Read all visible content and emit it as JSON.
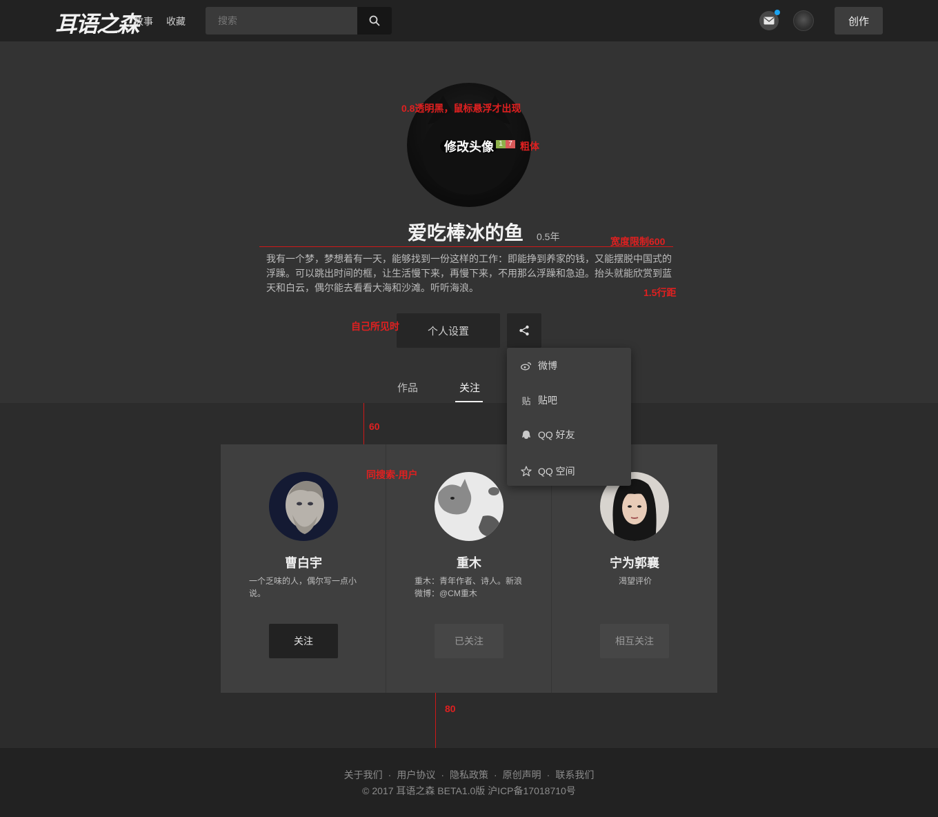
{
  "header": {
    "logo_text": "耳语之森",
    "nav": [
      "故事",
      "收藏"
    ],
    "search_placeholder": "搜索",
    "create_label": "创作"
  },
  "profile": {
    "edit_avatar_label": "修改头像",
    "edit_badge": [
      "1",
      "7"
    ],
    "username": "爱吃棒冰的鱼",
    "duration": "0.5年",
    "bio": "我有一个梦，梦想着有一天，能够找到一份这样的工作：即能挣到养家的钱，又能摆脱中国式的浮躁。可以跳出时间的框，让生活慢下来，再慢下来，不用那么浮躁和急迫。抬头就能欣赏到蓝天和白云，偶尔能去看看大海和沙滩。听听海浪。",
    "settings_label": "个人设置"
  },
  "tabs": [
    "作品",
    "关注"
  ],
  "share_menu": [
    {
      "icon": "weibo-icon",
      "label": "微博"
    },
    {
      "icon": "tieba-icon",
      "label": "贴吧",
      "icon_text": "贴"
    },
    {
      "icon": "qq-icon",
      "label": "QQ 好友"
    },
    {
      "icon": "star-icon",
      "label": "QQ 空间"
    }
  ],
  "follow_cards": [
    {
      "name": "曹白宇",
      "desc": "一个乏味的人，偶尔写一点小说。",
      "button": "关注"
    },
    {
      "name": "重木",
      "desc": "重木：青年作者、诗人。新浪微博：@CM重木",
      "button": "已关注"
    },
    {
      "name": "宁为郭襄",
      "desc": "渴望评价",
      "button": "相互关注"
    }
  ],
  "annotations": {
    "overlay_note": "0.8透明黑，鼠标悬浮才出现",
    "bold_note": "粗体",
    "width_note": "宽度限制600",
    "line_height_note": "1.5行距",
    "self_visible_note": "自己所见时",
    "gap_top": "60",
    "same_search_note": "同搜索-用户",
    "gap_bottom": "80"
  },
  "footer": {
    "links": [
      "关于我们",
      "用户协议",
      "隐私政策",
      "原创声明",
      "联系我们"
    ],
    "separator": "·",
    "copyright": "© 2017 耳语之森 BETA1.0版 沪ICP备17018710号"
  },
  "colors": {
    "accent_blue": "#1aa3f0",
    "annotation_red": "#e02020",
    "header_bg": "#222222",
    "profile_bg": "#333333",
    "page_bg": "#2c2c2c"
  }
}
